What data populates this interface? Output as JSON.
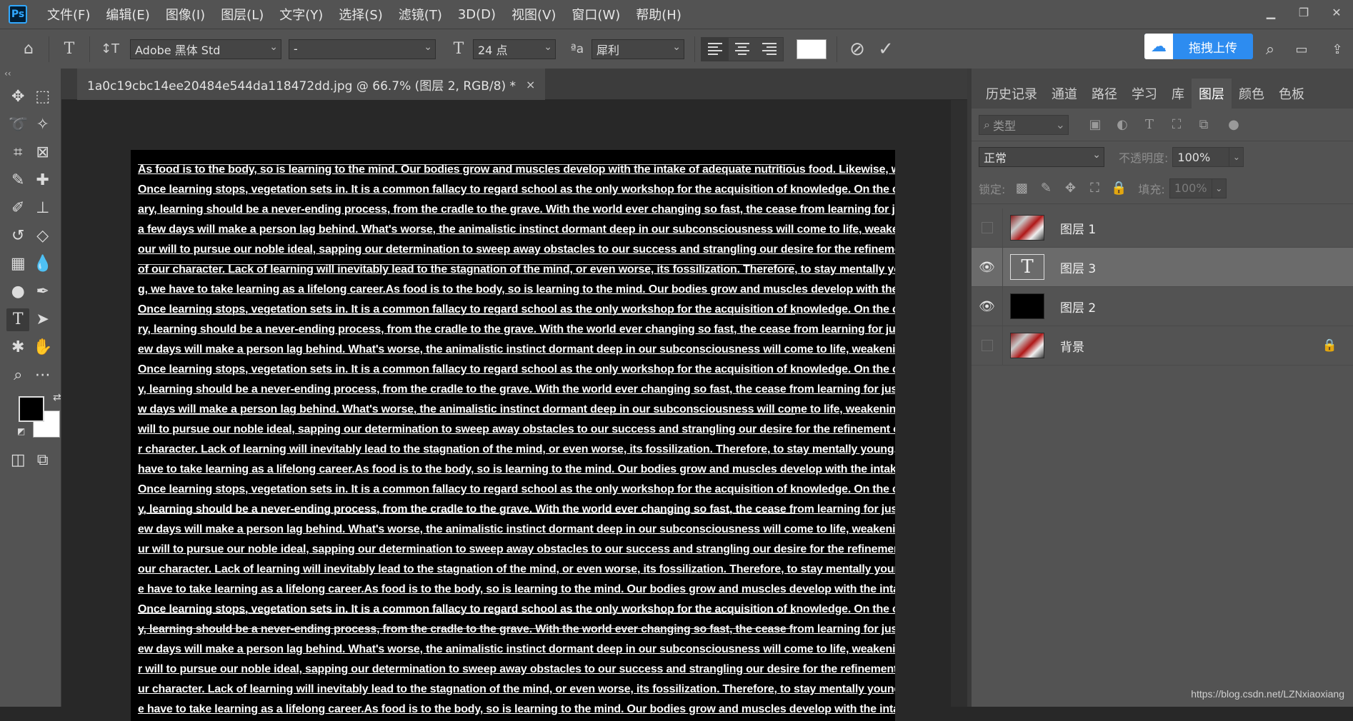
{
  "app": {
    "logo": "Ps"
  },
  "menu": [
    "文件(F)",
    "编辑(E)",
    "图像(I)",
    "图层(L)",
    "文字(Y)",
    "选择(S)",
    "滤镜(T)",
    "3D(D)",
    "视图(V)",
    "窗口(W)",
    "帮助(H)"
  ],
  "options": {
    "font_family": "Adobe 黑体 Std",
    "font_style": "-",
    "font_size": "24 点",
    "aa_label": "ªa",
    "antialias": "犀利",
    "upload_label": "拖拽上传"
  },
  "document": {
    "tab_title": "1a0c19cbc14ee20484e544da118472dd.jpg @ 66.7% (图层 2, RGB/8) *",
    "close": "×",
    "lines": [
      "As food is to the body, so is learning to the mind. Our bodies grow and muscles develop with the intake of adequate nutritious food. Likewise, we sl",
      "Once learning stops, vegetation sets in. It is a common fallacy to regard school as the only workshop for the acquisition of knowledge. On the contr",
      "ary, learning should be a never-ending process, from the cradle to the grave. With the world ever changing so fast, the cease from learning for just",
      "a few days will make a person lag behind. What's worse, the animalistic instinct dormant deep in our subconsciousness will come to life, weakening",
      " our will to pursue our noble ideal, sapping our determination to sweep away obstacles to our success and strangling our desire for the refinement",
      "of our character. Lack of learning will inevitably lead to the stagnation of the mind, or even worse, its fossilization. Therefore, to stay mentally youn",
      "g, we have to take learning as a lifelong career.As food is to the body, so is learning to the mind. Our bodies grow and muscles develop with the inta",
      "Once learning stops, vegetation sets in. It is a common fallacy to regard school as the only workshop for the acquisition of knowledge. On the contr",
      "ry, learning should be a never-ending process, from the cradle to the grave. With the world ever changing so fast, the cease from learning for just a",
      "ew days will make a person lag behind. What's worse, the animalistic instinct dormant deep in our subconsciousness will come to life, weakening o",
      "Once learning stops, vegetation sets in. It is a common fallacy to regard school as the only workshop for the acquisition of knowledge. On the contr",
      "y, learning should be a never-ending process, from the cradle to the grave. With the world ever changing so fast, the cease from learning for just a f",
      "w days will make a person lag behind. What's worse, the animalistic instinct dormant deep in our subconsciousness will come to life, weakening ou",
      "will to pursue our noble ideal, sapping our determination to sweep away obstacles to our success and strangling our desire for the refinement of ou",
      "r character. Lack of learning will inevitably lead to the stagnation of the mind, or even worse, its fossilization. Therefore, to stay mentally young, we",
      "have to take learning as a lifelong career.As food is to the body, so is learning to the mind. Our bodies grow and muscles develop with the intake of",
      "Once learning stops, vegetation sets in. It is a common fallacy to regard school as the only workshop for the acquisition of knowledge. On the contr",
      "y, learning should be a never-ending process, from the cradle to the grave. With the world ever changing so fast, the cease from learning for just a f",
      "ew days will make a person lag behind. What's worse, the animalistic instinct dormant deep in our subconsciousness will come to life, weakening o",
      "ur will to pursue our noble ideal, sapping our determination to sweep away obstacles to our success and strangling our desire for the refinement of",
      "our character. Lack of learning will inevitably lead to the stagnation of the mind, or even worse, its fossilization. Therefore, to stay mentally young, v",
      "e have to take learning as a lifelong career.As food is to the body, so is learning to the mind. Our bodies grow and muscles develop with the intake c",
      "Once learning stops, vegetation sets in. It is a common fallacy to regard school as the only workshop for the acquisition of knowledge. On the contr",
      "y, learning should be a never-ending process, from the cradle to the grave. With the world ever changing so fast, the cease from learning for just a f",
      "ew days will make a person lag behind. What's worse, the animalistic instinct dormant deep in our subconsciousness will come to life, weakening o",
      "r will to pursue our noble ideal, sapping our determination to sweep away obstacles to our success and strangling our desire for the refinement of c",
      "ur character. Lack of learning will inevitably lead to the stagnation of the mind, or even worse, its fossilization. Therefore, to stay mentally young,",
      "e have to take learning as a lifelong career.As food is to the body, so is learning to the mind. Our bodies grow and muscles develop with the intake c"
    ]
  },
  "panel": {
    "tabs": [
      "历史记录",
      "通道",
      "路径",
      "学习",
      "库",
      "图层",
      "颜色",
      "色板"
    ],
    "active_tab": "图层",
    "filter_kind": "类型",
    "blend_mode": "正常",
    "opacity_label": "不透明度:",
    "opacity": "100%",
    "lock_label": "锁定:",
    "fill_label": "填充:",
    "fill": "100%",
    "layers": [
      {
        "name": "图层 1",
        "visible": false,
        "thumb": "photo",
        "selected": false
      },
      {
        "name": "图层 3",
        "visible": true,
        "thumb": "text",
        "selected": true
      },
      {
        "name": "图层 2",
        "visible": true,
        "thumb": "black",
        "selected": false
      },
      {
        "name": "背景",
        "visible": false,
        "thumb": "photo",
        "selected": false,
        "locked": true
      }
    ]
  },
  "colors": {
    "foreground": "#000000",
    "background": "#ffffff",
    "accent": "#2d8cf0"
  },
  "watermark": "https://blog.csdn.net/LZNxiaoxiang"
}
